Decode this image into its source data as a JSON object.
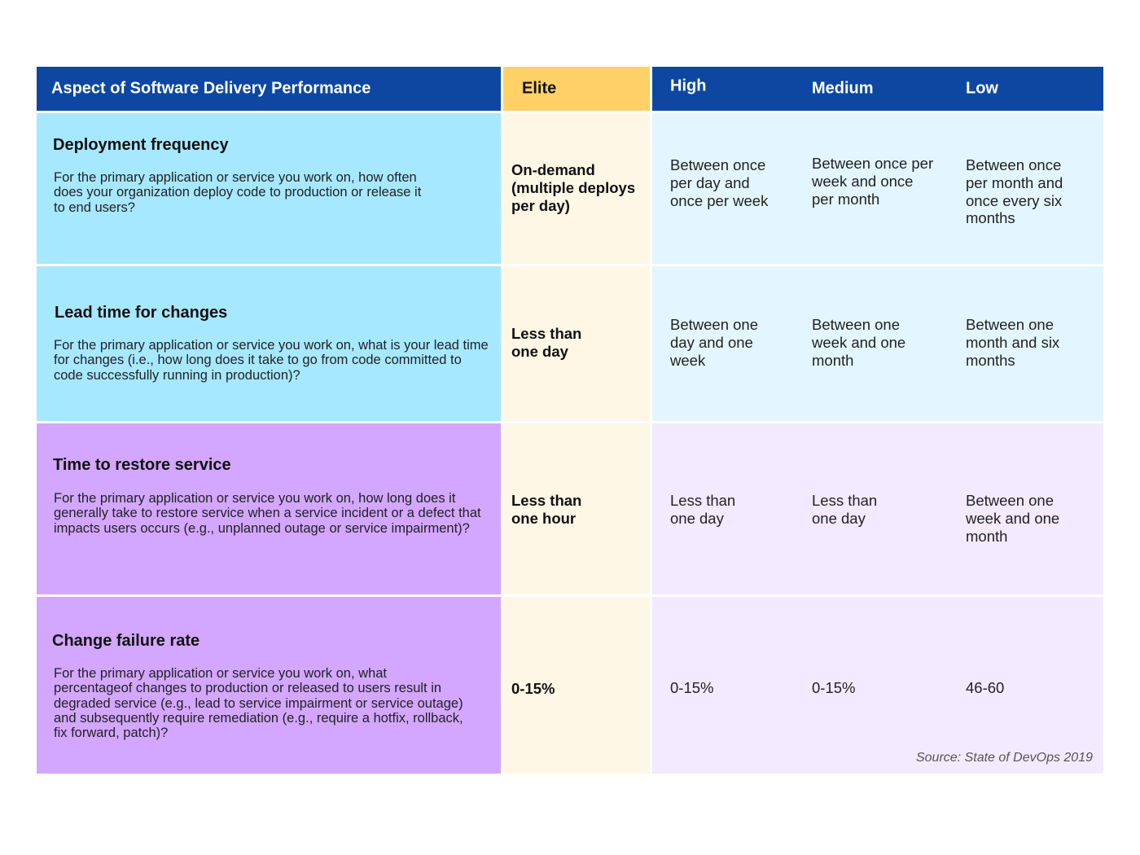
{
  "header": {
    "aspect": "Aspect of Software Delivery Performance",
    "elite": "Elite",
    "high": "High",
    "medium": "Medium",
    "low": "Low"
  },
  "rows": [
    {
      "title": "Deployment frequency",
      "description": "For the primary application or service you work on, how often does your organization deploy code to production or release it to end users?",
      "elite": "On-demand (multiple deploys per day)",
      "high": "Between once per day and once per week",
      "medium": "Between once per week and once per month",
      "low": "Between once per month and once every six months"
    },
    {
      "title": "Lead time for changes",
      "description": "For the primary application or service you work on, what is your lead time for changes (i.e., how long does it take to go from code committed to code successfully running in production)?",
      "elite": "Less than one day",
      "high": "Between one day and one week",
      "medium": "Between one week and one month",
      "low": "Between one month and six months"
    },
    {
      "title": "Time to restore service",
      "description": "For the primary application or service you work on, how long does it generally take to restore service when a service incident or a defect that impacts users occurs (e.g., unplanned outage or service impairment)?",
      "elite": "Less than one hour",
      "high": "Less than one day",
      "medium": "Less than one day",
      "low": "Between one week and one month"
    },
    {
      "title": "Change failure rate",
      "description": "For the primary application or service you work on, what percentageof changes to production or released to users result in degraded service (e.g., lead to service impairment or service outage) and subsequently require remediation (e.g., require a hotfix, rollback, fix forward, patch)?",
      "elite": "0-15%",
      "high": "0-15%",
      "medium": "0-15%",
      "low": "46-60"
    }
  ],
  "source": "Source: State of DevOps 2019",
  "colors": {
    "header_blue": "#0d47a1",
    "elite_yellow": "#ffd166",
    "row_blue": "#a6e8ff",
    "row_blue_light": "#e3f6ff",
    "row_purple": "#d3a6ff",
    "row_purple_light": "#f3eaff",
    "elite_cell": "#fff7e6"
  }
}
